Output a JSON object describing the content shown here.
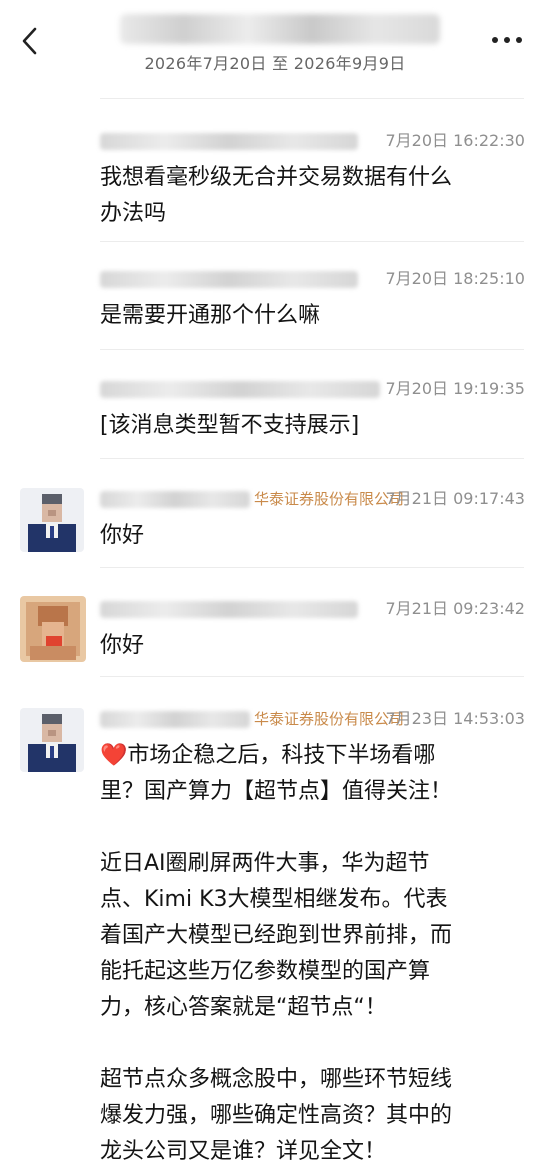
{
  "header": {
    "date_range": "2026年7月20日 至 2026年9月9日"
  },
  "messages": [
    {
      "sender_visible": "",
      "time": "7月20日 16:22:30",
      "lines": [
        "我想看毫秒级无合并交易数据有什么",
        "办法吗"
      ]
    },
    {
      "sender_visible": "",
      "time": "7月20日 18:25:10",
      "lines": [
        "是需要开通那个什么嘛"
      ]
    },
    {
      "sender_visible": "",
      "time": "7月20日 19:19:35",
      "lines": [
        "[该消息类型暂不支持展示]"
      ]
    },
    {
      "sender_visible": "华泰证券股份有限公司",
      "time": "7月21日 09:17:43",
      "lines": [
        "你好"
      ]
    },
    {
      "sender_visible": "",
      "time": "7月21日 09:23:42",
      "lines": [
        "你好"
      ]
    },
    {
      "sender_visible": "华泰证券股份有限公司",
      "time": "7月23日 14:53:03",
      "heart": "❤️",
      "paragraphs": [
        [
          "市场企稳之后，科技下半场看哪",
          "里？国产算力【超节点】值得关注！"
        ],
        [
          "近日AI圈刷屏两件大事，华为超节",
          "点、Kimi K3大模型相继发布。代表",
          "着国产大模型已经跑到世界前排，而",
          "能托起这些万亿参数模型的国产算",
          "力，核心答案就是“超节点“！"
        ],
        [
          "超节点众多概念股中，哪些环节短线",
          "爆发力强，哪些确定性高资？其中的",
          "龙头公司又是谁？详见全文！"
        ]
      ]
    }
  ]
}
